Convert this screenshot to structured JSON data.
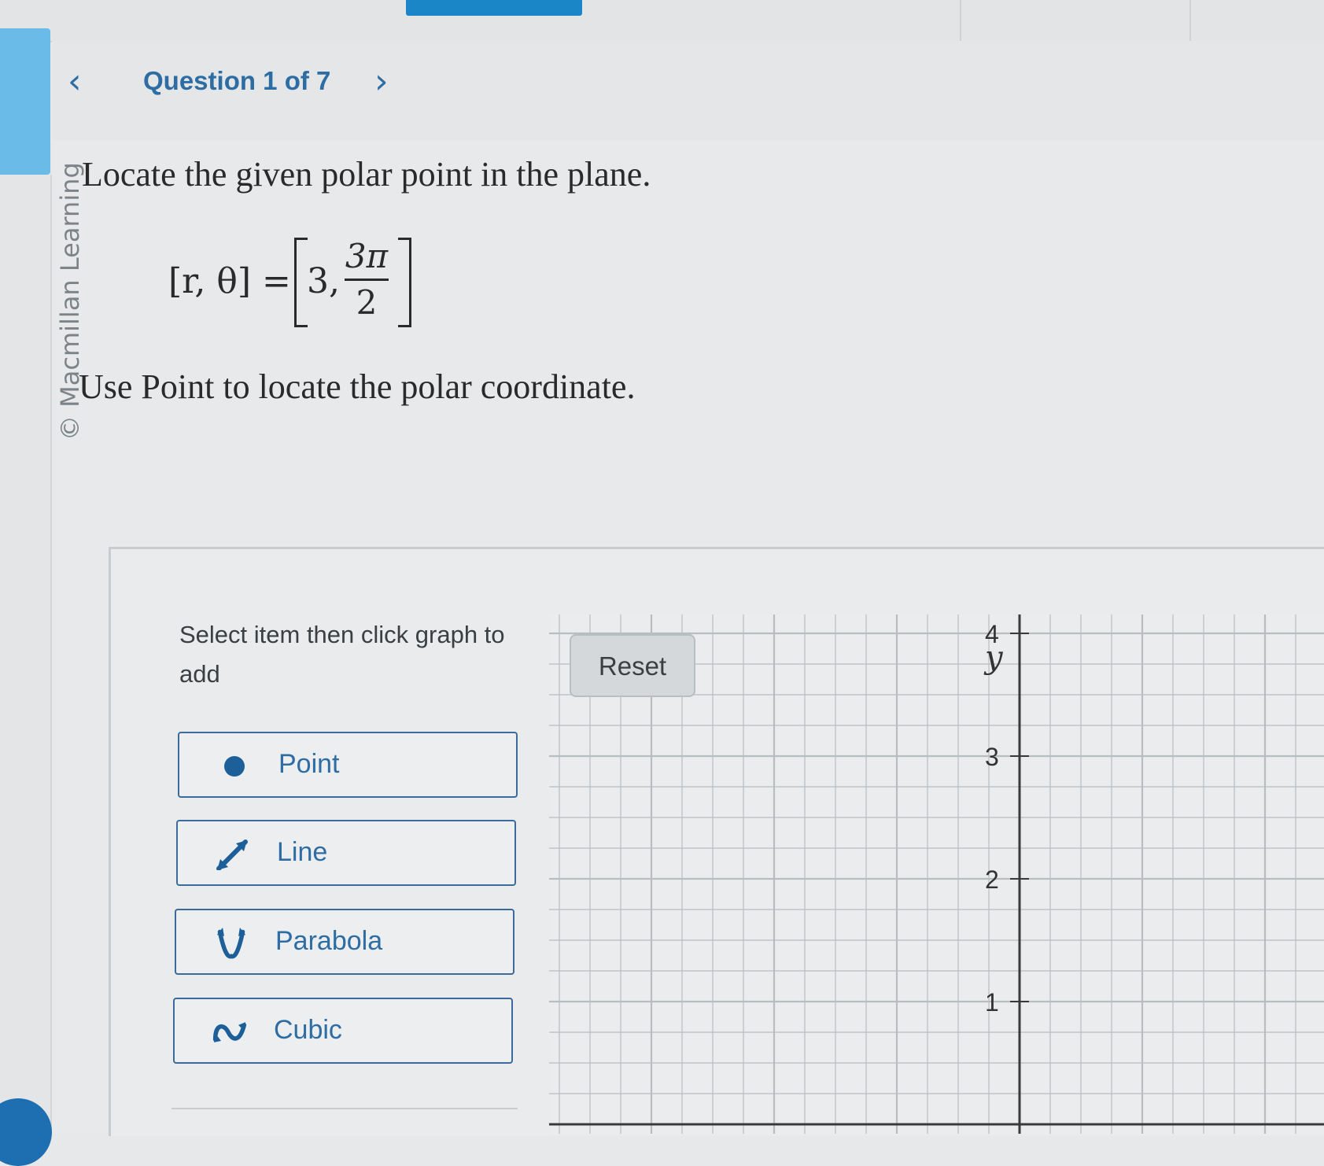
{
  "nav": {
    "prev_icon": "chevron-left-icon",
    "question_counter": "Question 1 of 7",
    "next_icon": "chevron-right-icon"
  },
  "sidebar": {
    "copyright": "© Macmillan Learning"
  },
  "question": {
    "prompt": "Locate the given polar point in the plane.",
    "formula_lhs": "[r, θ] = ",
    "formula_r": "3,",
    "formula_num": "3π",
    "formula_den": "2",
    "instruction": "Use Point to locate the polar coordinate."
  },
  "tools": {
    "hint": "Select item then click graph to add",
    "items": [
      {
        "label": "Point",
        "icon": "dot-icon"
      },
      {
        "label": "Line",
        "icon": "line-arrow-icon"
      },
      {
        "label": "Parabola",
        "icon": "parabola-icon"
      },
      {
        "label": "Cubic",
        "icon": "cubic-icon"
      }
    ]
  },
  "graph": {
    "reset_label": "Reset",
    "y_axis_label": "y",
    "y_tick_labels": [
      "4",
      "3",
      "2",
      "1"
    ],
    "grid_color": "#b8bdc0",
    "axis_color": "#3a3a3a"
  },
  "colors": {
    "accent": "#2e6da4",
    "nav_blue": "#1a86c8"
  }
}
